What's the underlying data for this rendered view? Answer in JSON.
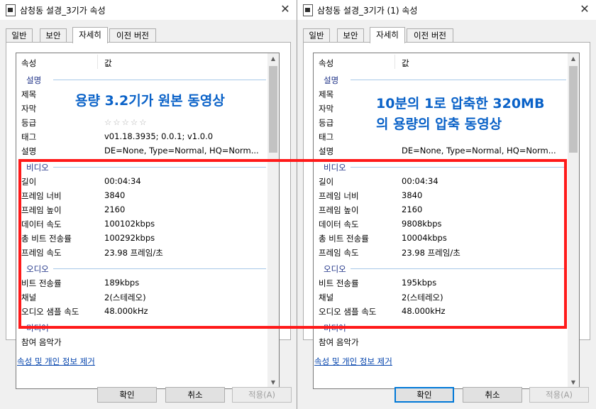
{
  "left": {
    "title": "삼청동 설경_3기가 속성",
    "tabs": [
      "일반",
      "보안",
      "자세히",
      "이전 버전"
    ],
    "header": {
      "property": "속성",
      "value": "값"
    },
    "groups": {
      "description": "설명",
      "video": "비디오",
      "audio": "오디오",
      "media": "미디어"
    },
    "fields": {
      "title": "제목",
      "subtitle": "자막",
      "rating": "등급",
      "tags": "태그",
      "comments": "설명",
      "length": "길이",
      "frame_width": "프레임 너비",
      "frame_height": "프레임 높이",
      "data_rate": "데이터 속도",
      "total_bitrate": "총 비트 전송률",
      "frame_rate": "프레임 속도",
      "bitrate": "비트 전송률",
      "channels": "채널",
      "sample_rate": "오디오 샘플 속도",
      "contributing_artists": "참여 음악가"
    },
    "values": {
      "rating_stars": "☆☆☆☆☆",
      "tags": "v01.18.3935; 0.0.1; v1.0.0",
      "comments": "DE=None, Type=Normal, HQ=Norm...",
      "length": "00:04:34",
      "frame_width": "3840",
      "frame_height": "2160",
      "data_rate": "100102kbps",
      "total_bitrate": "100292kbps",
      "frame_rate": "23.98 프레임/초",
      "audio_bitrate": "189kbps",
      "channels": "2(스테레오)",
      "sample_rate": "48.000kHz"
    },
    "remove_link": "속성 및 개인 정보 제거",
    "buttons": {
      "ok": "확인",
      "cancel": "취소",
      "apply": "적용(A)"
    }
  },
  "right": {
    "title": "삼청동 설경_3기가 (1) 속성",
    "tabs": [
      "일반",
      "보안",
      "자세히",
      "이전 버전"
    ],
    "header": {
      "property": "속성",
      "value": "값"
    },
    "groups": {
      "description": "설명",
      "video": "비디오",
      "audio": "오디오",
      "media": "미디어"
    },
    "fields": {
      "title": "제목",
      "subtitle": "자막",
      "rating": "등급",
      "tags": "태그",
      "comments": "설명",
      "length": "길이",
      "frame_width": "프레임 너비",
      "frame_height": "프레임 높이",
      "data_rate": "데이터 속도",
      "total_bitrate": "총 비트 전송률",
      "frame_rate": "프레임 속도",
      "bitrate": "비트 전송률",
      "channels": "채널",
      "sample_rate": "오디오 샘플 속도",
      "contributing_artists": "참여 음악가"
    },
    "values": {
      "rating_stars": "☆",
      "comments": "DE=None, Type=Normal, HQ=Norm...",
      "length": "00:04:34",
      "frame_width": "3840",
      "frame_height": "2160",
      "data_rate": "9808kbps",
      "total_bitrate": "10004kbps",
      "frame_rate": "23.98 프레임/초",
      "audio_bitrate": "195kbps",
      "channels": "2(스테레오)",
      "sample_rate": "48.000kHz"
    },
    "remove_link": "속성 및 개인 정보 제거",
    "buttons": {
      "ok": "확인",
      "cancel": "취소",
      "apply": "적용(A)"
    }
  },
  "annotations": {
    "left": "용량 3.2기가 원본 동영상",
    "right_line1": "10분의 1로 압축한 320MB",
    "right_line2": "의 용량의 압축 동영상",
    "highlight_color": "#ff1a1a",
    "text_color": "#0a62c8"
  }
}
